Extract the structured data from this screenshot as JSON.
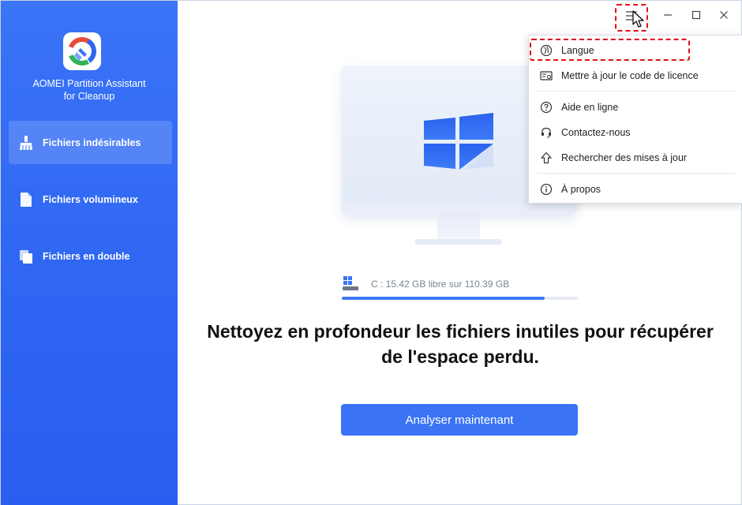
{
  "app": {
    "name_line1": "AOMEI Partition Assistant",
    "name_line2": "for Cleanup",
    "accent": "#2f66f2"
  },
  "sidebar": {
    "items": [
      {
        "label": "Fichiers indésirables",
        "icon": "broom-icon",
        "active": true
      },
      {
        "label": "Fichiers volumineux",
        "icon": "file-icon",
        "active": false
      },
      {
        "label": "Fichiers en double",
        "icon": "duplicate-files-icon",
        "active": false
      }
    ]
  },
  "titlebar": {
    "icons": [
      "hamburger-menu-icon",
      "minimize-icon",
      "maximize-icon",
      "close-icon"
    ]
  },
  "main": {
    "disk_label": "C : 15.42 GB libre sur 110.39 GB",
    "disk_used_fraction": 0.86,
    "headline_line1": "Nettoyez en profondeur les fichiers inutiles pour récupérer",
    "headline_line2": "de l'espace perdu.",
    "scan_button": "Analyser maintenant"
  },
  "menu": {
    "items": [
      {
        "label": "Langue",
        "icon": "language-icon",
        "highlighted": true
      },
      {
        "label": "Mettre à jour le code de licence",
        "icon": "license-icon"
      },
      {
        "label": "Aide en ligne",
        "icon": "help-icon"
      },
      {
        "label": "Contactez-nous",
        "icon": "headset-icon"
      },
      {
        "label": "Rechercher des mises à jour",
        "icon": "update-arrow-icon"
      },
      {
        "label": "À propos",
        "icon": "info-icon"
      }
    ],
    "highlight_color": "#e0101a"
  }
}
